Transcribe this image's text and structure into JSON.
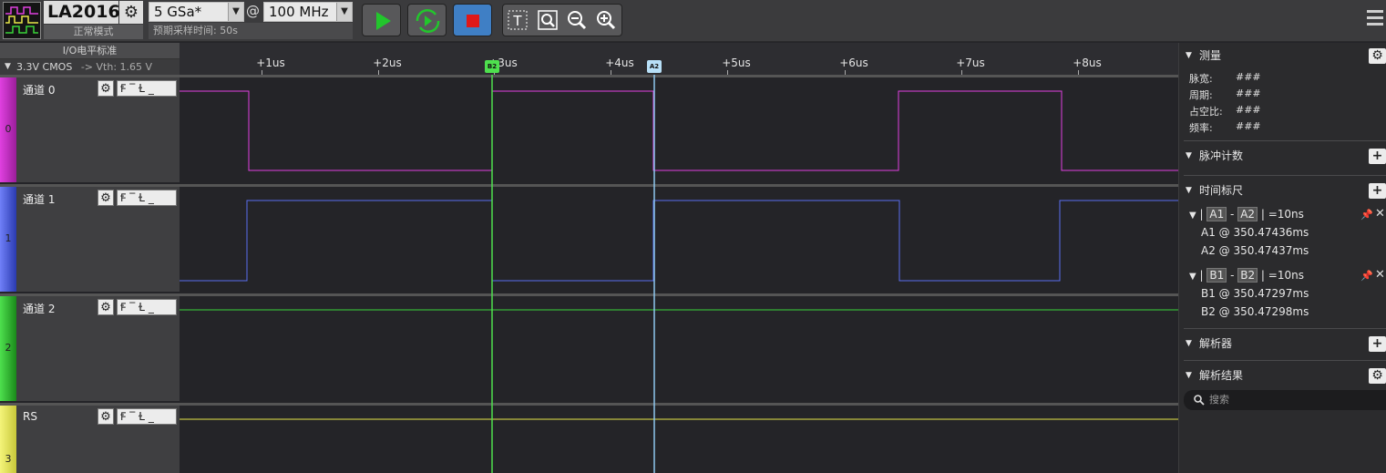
{
  "device": {
    "name": "LA2016",
    "mode": "正常模式"
  },
  "acquisition": {
    "sample_rate": "5 GSa*",
    "at": "@",
    "depth": "100 MHz",
    "estimate": "预期采样时间: 50s"
  },
  "io": {
    "header": "I/O电平标准",
    "level": "3.3V CMOS",
    "vth": "-> Vth: 1.65 V"
  },
  "timeline": {
    "ticks": [
      "+1us",
      "+2us",
      "+3us",
      "+4us",
      "+5us",
      "+6us",
      "+7us",
      "+8us"
    ]
  },
  "channels": [
    {
      "label": "通道 0",
      "index": "0",
      "color": "#e040e0"
    },
    {
      "label": "通道 1",
      "index": "1",
      "color": "#5a6ef0"
    },
    {
      "label": "通道 2",
      "index": "2",
      "color": "#3ad43a"
    },
    {
      "label": "RS",
      "index": "3",
      "color": "#e8e84a"
    }
  ],
  "cursors": {
    "b2": "B2",
    "a2": "A2"
  },
  "measurements": {
    "title": "测量",
    "items": [
      {
        "label": "脉宽:",
        "value": "###"
      },
      {
        "label": "周期:",
        "value": "###"
      },
      {
        "label": "占空比:",
        "value": "###"
      },
      {
        "label": "频率:",
        "value": "###"
      }
    ]
  },
  "pulse_count": {
    "title": "脉冲计数"
  },
  "time_ruler": {
    "title": "时间标尺",
    "a": {
      "name1": "A1",
      "name2": "A2",
      "diff": "=10ns",
      "p1": "A1 @ 350.47436ms",
      "p2": "A2 @ 350.47437ms"
    },
    "b": {
      "name1": "B1",
      "name2": "B2",
      "diff": "=10ns",
      "p1": "B1 @ 350.47297ms",
      "p2": "B2 @ 350.47298ms"
    }
  },
  "analyzer": {
    "title": "解析器"
  },
  "results": {
    "title": "解析结果",
    "search_placeholder": "搜索"
  }
}
